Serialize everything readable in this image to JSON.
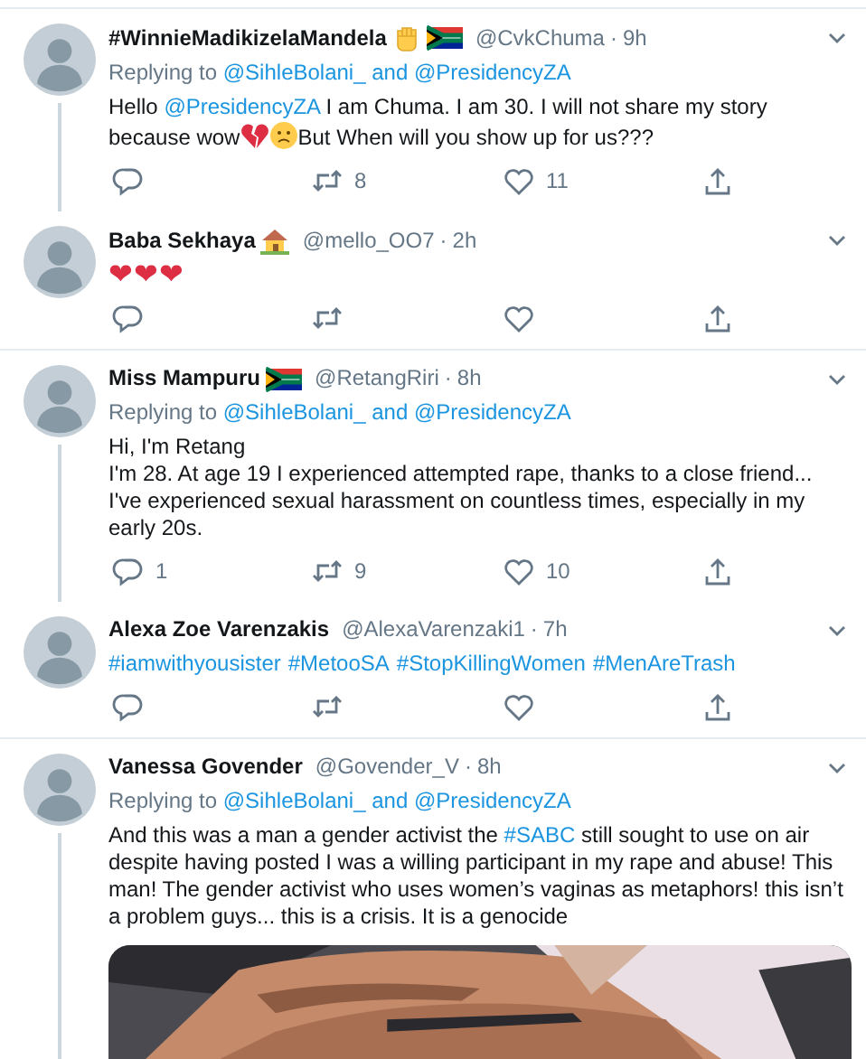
{
  "tweets": [
    {
      "name": "#WinnieMadikizelaMandela",
      "name_icons": [
        {
          "kind": "fist"
        },
        {
          "kind": "flag"
        }
      ],
      "handle": "@CvkChuma",
      "separator": "·",
      "time": "9h",
      "thread_line": true,
      "replying": {
        "prefix": "Replying to",
        "targets": "@SihleBolani_ and @PresidencyZA"
      },
      "body": [
        [
          {
            "kind": "text",
            "text": "Hello "
          },
          {
            "kind": "link",
            "text": "@PresidencyZA"
          },
          {
            "kind": "text",
            "text": " I am Chuma. I am 30. I will not share my story because wow"
          },
          {
            "kind": "broken-heart"
          },
          {
            "kind": "frown"
          },
          {
            "kind": "text",
            "text": "But When will you show up for us???"
          }
        ]
      ],
      "actions": {
        "retweet": "8",
        "like": "11"
      }
    },
    {
      "name": "Baba Sekhaya",
      "name_icons": [
        {
          "kind": "house"
        }
      ],
      "handle": "@mello_OO7",
      "separator": "·",
      "time": "2h",
      "thread_line": false,
      "body": [
        [
          {
            "kind": "hearts",
            "text": "❤❤❤"
          }
        ]
      ],
      "actions": {
        "shown": true
      }
    },
    {
      "name": "Miss Mampuru",
      "name_icons": [
        {
          "kind": "flag"
        }
      ],
      "handle": "@RetangRiri",
      "separator": "·",
      "time": "8h",
      "thread_line": true,
      "replying": {
        "prefix": "Replying to",
        "targets": "@SihleBolani_ and @PresidencyZA"
      },
      "body": [
        [
          {
            "kind": "text",
            "text": "Hi, I'm Retang"
          }
        ],
        [
          {
            "kind": "text",
            "text": "I'm 28. At age 19 I experienced attempted rape, thanks to a close friend..."
          }
        ],
        [
          {
            "kind": "text",
            "text": "I've experienced sexual harassment on countless times, especially in my early 20s."
          }
        ]
      ],
      "actions": {
        "reply": "1",
        "retweet": "9",
        "like": "10"
      }
    },
    {
      "name": "Alexa Zoe Varenzakis",
      "handle": "@AlexaVarenzaki1",
      "separator": "·",
      "time": "7h",
      "thread_line": false,
      "body": [
        [
          {
            "kind": "link",
            "text": "#iamwithyousister"
          },
          {
            "kind": "link",
            "text": "#MetooSA"
          },
          {
            "kind": "link",
            "text": "#StopKillingWomen"
          },
          {
            "kind": "link",
            "text": "#MenAreTrash"
          }
        ]
      ],
      "actions": {
        "shown": true
      }
    },
    {
      "name": "Vanessa Govender",
      "handle": "@Govender_V",
      "separator": "·",
      "time": "8h",
      "thread_line": true,
      "replying": {
        "prefix": "Replying to",
        "targets": "@SihleBolani_ and @PresidencyZA"
      },
      "body": [
        [
          {
            "kind": "text",
            "text": "And this was a man a gender activist the "
          },
          {
            "kind": "link",
            "text": "#SABC"
          },
          {
            "kind": "text",
            "text": " still sought to use on air despite having posted I was a willing participant in my rape and abuse! This man!  The gender activist who uses women’s vaginas as metaphors! this isn’t a problem guys... this is a crisis. It is a genocide"
          }
        ]
      ],
      "media": {
        "kind": "picture"
      }
    }
  ]
}
